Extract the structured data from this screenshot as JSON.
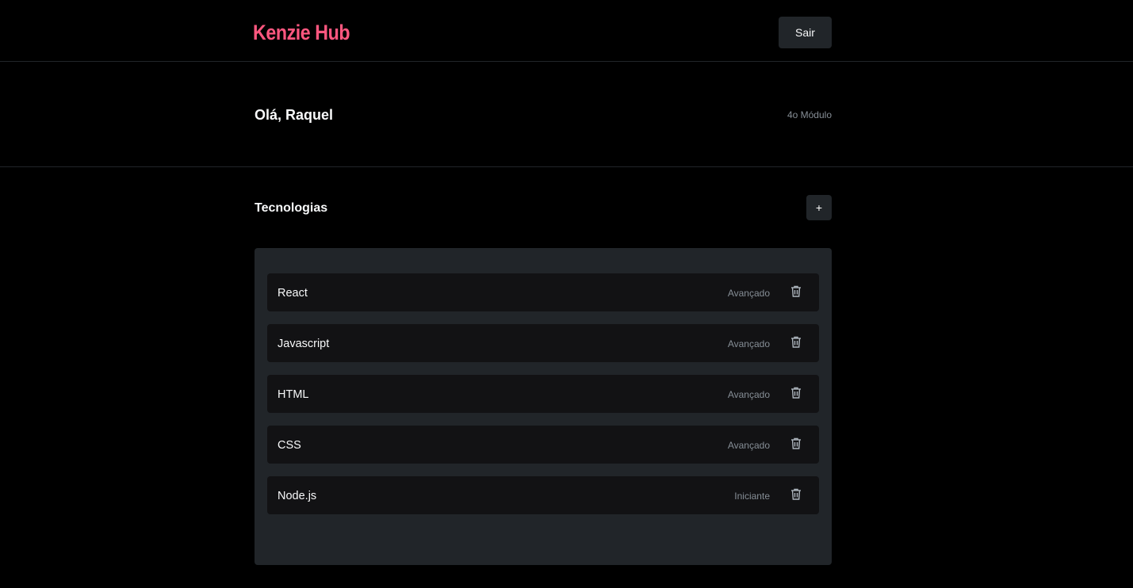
{
  "header": {
    "logo": "Kenzie Hub",
    "logout_label": "Sair"
  },
  "greeting": {
    "title": "Olá, Raquel",
    "module": "4o Módulo"
  },
  "technologies": {
    "title": "Tecnologias",
    "add_label": "+",
    "items": [
      {
        "name": "React",
        "status": "Avançado"
      },
      {
        "name": "Javascript",
        "status": "Avançado"
      },
      {
        "name": "HTML",
        "status": "Avançado"
      },
      {
        "name": "CSS",
        "status": "Avançado"
      },
      {
        "name": "Node.js",
        "status": "Iniciante"
      }
    ]
  },
  "icons": {
    "delete": "trash-icon"
  },
  "colors": {
    "brand": "#ff577f",
    "background": "#000000",
    "surface": "#212529",
    "card": "#121214",
    "muted_text": "#868e96"
  }
}
